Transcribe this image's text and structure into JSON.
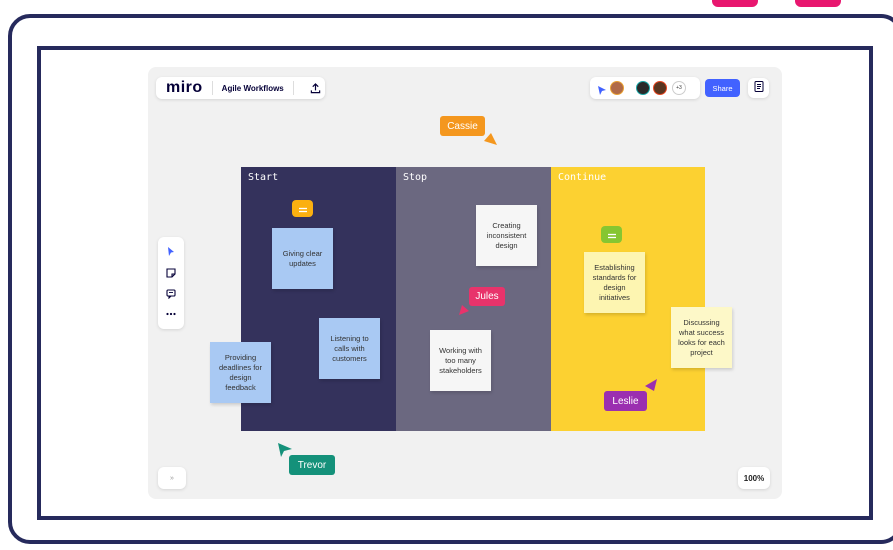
{
  "app": {
    "logo": "miro",
    "board_title": "Agile Workflows",
    "share_label": "Share",
    "more_collaborators": "+3",
    "zoom": "100%",
    "expand_label": "»"
  },
  "icons": {
    "upload": "upload-icon",
    "notes": "notes-icon",
    "select": "cursor-select-icon",
    "sticky": "sticky-note-icon",
    "comment": "comment-icon",
    "more": "more-icon"
  },
  "columns": [
    {
      "title": "Start",
      "color": "#34325c",
      "title_color": "#ffffff"
    },
    {
      "title": "Stop",
      "color": "#6b6880",
      "title_color": "#ffffff"
    },
    {
      "title": "Continue",
      "color": "#fcd131",
      "title_color": "#ffffff"
    }
  ],
  "stickies": {
    "giving_clear_updates": "Giving clear updates",
    "listening_to_calls": "Listening to calls with customers",
    "providing_deadlines": "Providing deadlines for design feedback",
    "creating_inconsistent_design": "Creating inconsistent design",
    "working_with_stakeholders": "Working with too many stakeholders",
    "establishing_standards": "Establishing standards for design initiatives",
    "discussing_success": "Discussing what success looks for each project"
  },
  "cursors": {
    "cassie": {
      "name": "Cassie",
      "color": "#f4971e"
    },
    "jules": {
      "name": "Jules",
      "color": "#e8336b"
    },
    "leslie": {
      "name": "Leslie",
      "color": "#9b2fb0"
    },
    "trevor": {
      "name": "Trevor",
      "color": "#14917a"
    }
  },
  "colors": {
    "frame": "#262a5c",
    "accent_pink": "#e8176f",
    "share": "#4262ff",
    "sticky_blue": "#a9c9f3",
    "sticky_white": "#f6f6f6",
    "sticky_yellow": "#fdf5b1",
    "sticky_light_yellow": "#fdf8c8",
    "comment_orange": "#fbb010",
    "comment_green": "#86c631"
  }
}
